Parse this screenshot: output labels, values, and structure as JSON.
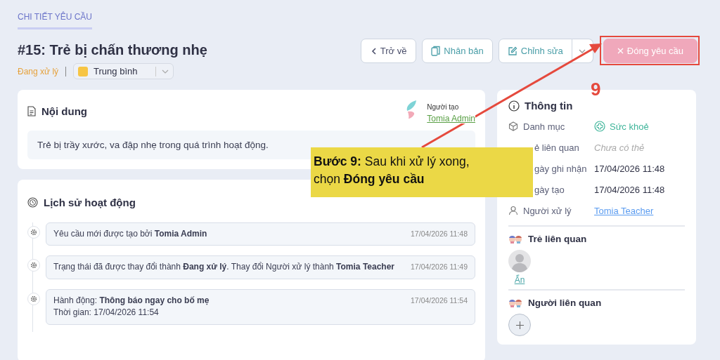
{
  "breadcrumb": "CHI TIẾT YÊU CẦU",
  "title": "#15: Trẻ bị chấn thương nhẹ",
  "status": "Đang xử lý",
  "priority": {
    "label": "Trung bình",
    "color": "#f7c544"
  },
  "actions": [
    {
      "kind": "back",
      "label": "Trở về"
    },
    {
      "kind": "duplicate",
      "label": "Nhân bản"
    },
    {
      "kind": "edit",
      "label": "Chỉnh sửa",
      "menu": true
    },
    {
      "kind": "close",
      "label": "Đóng yêu cầu"
    }
  ],
  "content": {
    "title": "Nội dung",
    "creator_label": "Người tạo",
    "creator": "Tomia Admin",
    "text": "Trẻ bị trầy xước, va đập nhẹ trong quá trình hoạt động."
  },
  "history": {
    "title": "Lịch sử hoạt động",
    "entries": [
      {
        "lines": [
          "Yêu cầu mới được tạo bởi **Tomia Admin**"
        ],
        "time": "17/04/2026 11:48"
      },
      {
        "lines": [
          "Trạng thái đã được thay đổi thành **Đang xử lý**. Thay đổi Người xử lý thành **Tomia Teacher**"
        ],
        "time": "17/04/2026 11:49"
      },
      {
        "lines": [
          "Hành động: **Thông báo ngay cho bố mẹ**",
          "Thời gian: 17/04/2026 11:54"
        ],
        "time": "17/04/2026 11:54"
      }
    ]
  },
  "info": {
    "title": "Thông tin",
    "fields": [
      {
        "kind": "category",
        "label": "Danh mục",
        "value": "Sức khoẻ"
      },
      {
        "kind": "empty",
        "label": "ẻ liên quan",
        "value": "Chưa có thẻ"
      },
      {
        "kind": "date",
        "label": "gày ghi nhận",
        "value": "17/04/2026 11:48"
      },
      {
        "kind": "date",
        "label": "gày tạo",
        "value": "17/04/2026 11:48"
      },
      {
        "kind": "link",
        "label": "Người xử lý",
        "value": "Tomia Teacher"
      }
    ]
  },
  "children": {
    "title": "Trẻ liên quan",
    "items": [
      {
        "name": "Ẩn"
      }
    ]
  },
  "related_people": {
    "title": "Người liên quan"
  },
  "annotation": {
    "step_number": "9",
    "callout": [
      "**Bước 9:** Sau khi xử lý xong,",
      "chọn **Đóng yêu cầu**"
    ]
  }
}
